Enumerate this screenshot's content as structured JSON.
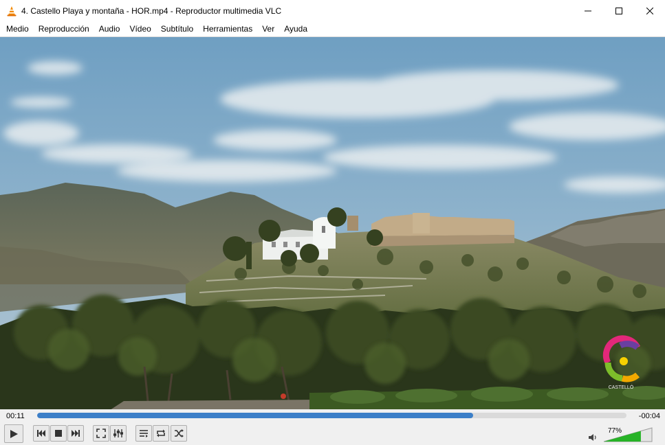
{
  "window": {
    "title": "4. Castello Playa y montaña - HOR.mp4 - Reproductor multimedia VLC",
    "icon": "vlc-cone-icon"
  },
  "menu": {
    "items": [
      "Medio",
      "Reproducción",
      "Audio",
      "Vídeo",
      "Subtítulo",
      "Herramientas",
      "Ver",
      "Ayuda"
    ]
  },
  "playback": {
    "elapsed": "00:11",
    "remaining": "-00:04",
    "progress_fraction": 0.74,
    "watermark_text": "CASTELLÓ"
  },
  "volume": {
    "label": "77%",
    "level_fraction": 0.77
  },
  "colors": {
    "seek_fill": "#3c7fc8",
    "volume_fill": "#27b327",
    "vlc_orange": "#f38a00"
  },
  "icons": {
    "play": "play-icon",
    "prev": "previous-icon",
    "stop": "stop-icon",
    "next": "next-icon",
    "fullscreen": "fullscreen-icon",
    "extended": "extended-settings-icon",
    "playlist": "playlist-icon",
    "loop": "loop-icon",
    "shuffle": "shuffle-icon",
    "volume": "speaker-icon"
  }
}
